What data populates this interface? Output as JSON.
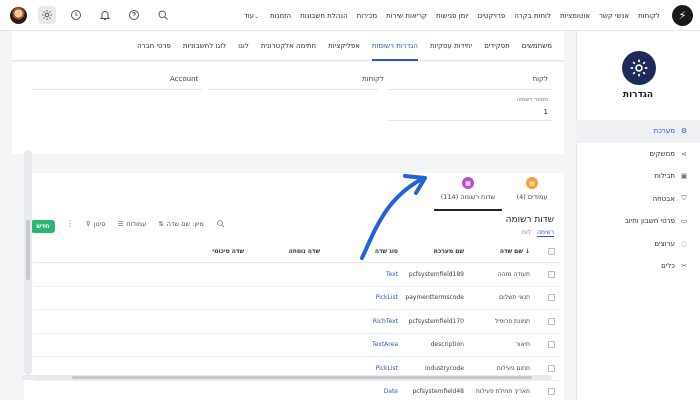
{
  "topbar": {
    "nav": [
      "לקוחות",
      "אנשי קשר",
      "אוטומציות",
      "לוחות בקרה",
      "פרויקטים",
      "יומן פגישות",
      "קריאות שירות",
      "מכירות",
      "הנהלת חשבונות",
      "הזמנות",
      "עוד"
    ],
    "icons": [
      "search-icon",
      "help-icon",
      "bell-icon",
      "clock-icon",
      "gear-icon",
      "avatar"
    ]
  },
  "sidebar": {
    "title": "הגדרות",
    "items": [
      {
        "label": "מערכת",
        "icon": "gear-icon",
        "active": true
      },
      {
        "label": "ממשקים",
        "icon": "share-icon",
        "active": false
      },
      {
        "label": "חבילות",
        "icon": "package-icon",
        "active": false
      },
      {
        "label": "אבטחה",
        "icon": "shield-icon",
        "active": false
      },
      {
        "label": "פרטי חשבון וחיוב",
        "icon": "card-icon",
        "active": false
      },
      {
        "label": "ערוצים",
        "icon": "channels-icon",
        "active": false
      },
      {
        "label": "כלים",
        "icon": "tools-icon",
        "active": false
      }
    ]
  },
  "tabs": [
    "משתמשים",
    "תפקידים",
    "יחידות עסקיות",
    "הגדרות רשומות",
    "אפליקציות",
    "חתימה אלקטרונית",
    "לוגו",
    "לוגו לחשבוניות",
    "פרטי חברה"
  ],
  "active_tab": "הגדרות רשומות",
  "form": {
    "entity_label": "לקוח",
    "plural_label": "לקוחות",
    "english_label": "Account",
    "record_number_label": "מספר רשומה",
    "record_number_value": "1"
  },
  "list": {
    "tabs": [
      {
        "label": "עמודים (4)",
        "color": "#f0a23b"
      },
      {
        "label": "שדות רשומה (114)",
        "color": "#b84fc9"
      }
    ],
    "title": "שדות רשומה",
    "subtabs": [
      "רשימה",
      "לוח"
    ],
    "new_button": "חדש",
    "toolbar": {
      "filter": "סינון",
      "columns": "עמודות",
      "sort": "מיון: שם שדה"
    },
    "columns": {
      "name": "שם שדה",
      "system": "שם מערכת",
      "type": "סוג שדה",
      "extra": "שדה נוסחה",
      "summary": "שדה סיכומי"
    },
    "rows": [
      {
        "name": "תעודה מזהה",
        "system": "pcfsystemfield189",
        "type": "Text"
      },
      {
        "name": "תנאי תשלום",
        "system": "paymenttermscode",
        "type": "PickList"
      },
      {
        "name": "תמונת פרופיל",
        "system": "pcfsystemfield170",
        "type": "RichText"
      },
      {
        "name": "תיאור",
        "system": "description",
        "type": "TextArea"
      },
      {
        "name": "תחום פעילות",
        "system": "industrycode",
        "type": "PickList"
      },
      {
        "name": "תאריך תחילת פעילות",
        "system": "pcfsystemfield48",
        "type": "Date"
      }
    ]
  },
  "colors": {
    "accent": "#2d57c9",
    "new_button": "#2bb673",
    "sidebar_icon_bg": "#1f2a5c"
  }
}
